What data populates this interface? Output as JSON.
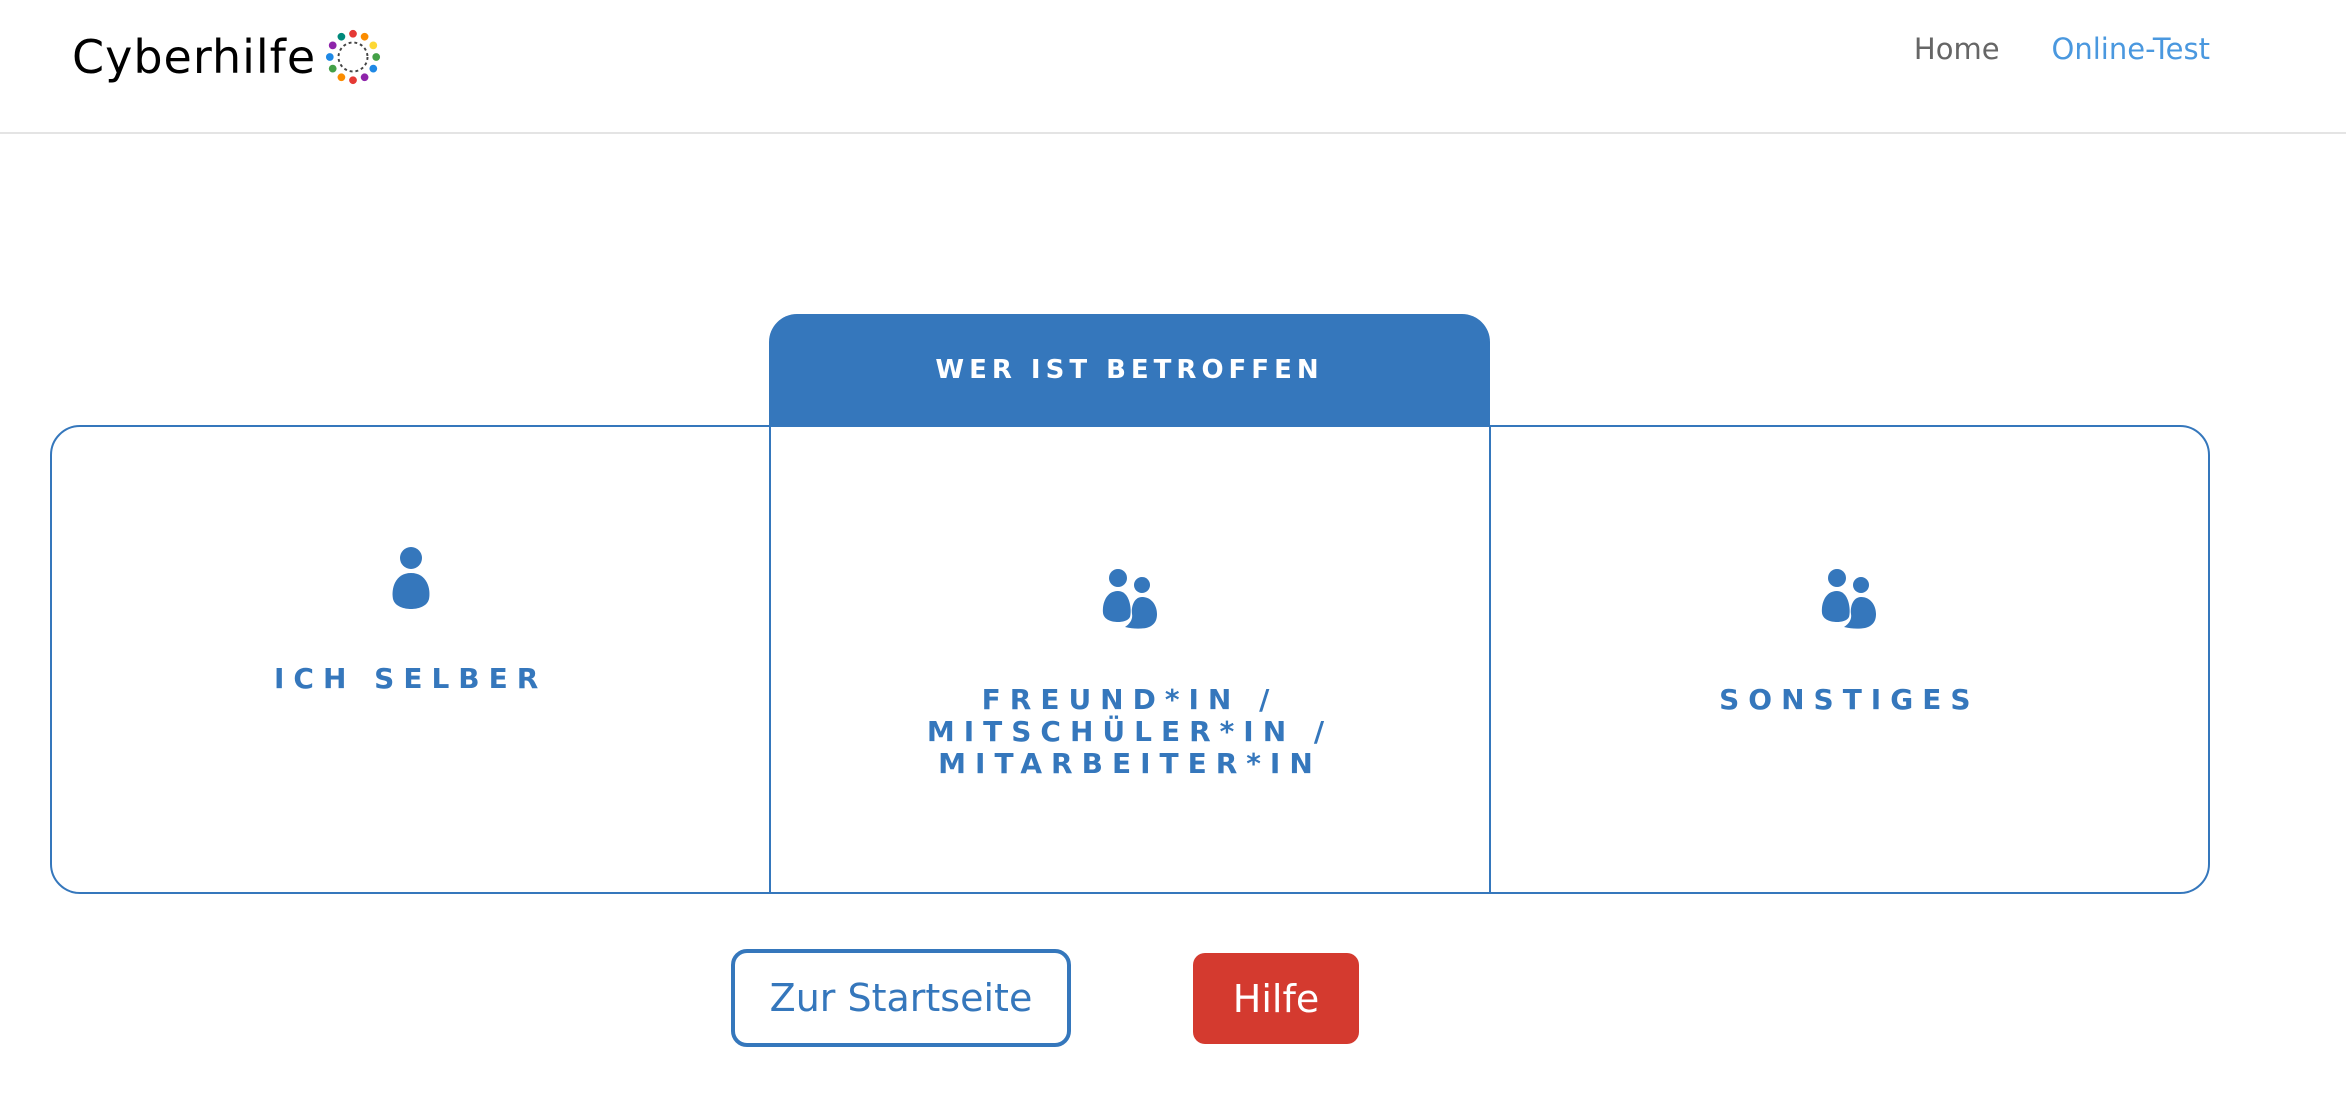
{
  "header": {
    "logo_text": "Cyberhilfe",
    "nav": {
      "home": "Home",
      "online_test": "Online-Test"
    }
  },
  "quiz": {
    "question": "WER IST BETROFFEN",
    "options": [
      {
        "label": "ICH SELBER",
        "icon": "person-icon"
      },
      {
        "label": "FREUND*IN / MITSCHÜLER*IN / MITARBEITER*IN",
        "icon": "two-people-icon"
      },
      {
        "label": "SONSTIGES",
        "icon": "two-people-icon"
      }
    ]
  },
  "actions": {
    "start_label": "Zur Startseite",
    "help_label": "Hilfe"
  },
  "colors": {
    "primary_blue": "#3577bc",
    "nav_active": "#4a98df",
    "help_red": "#d43a2f"
  }
}
